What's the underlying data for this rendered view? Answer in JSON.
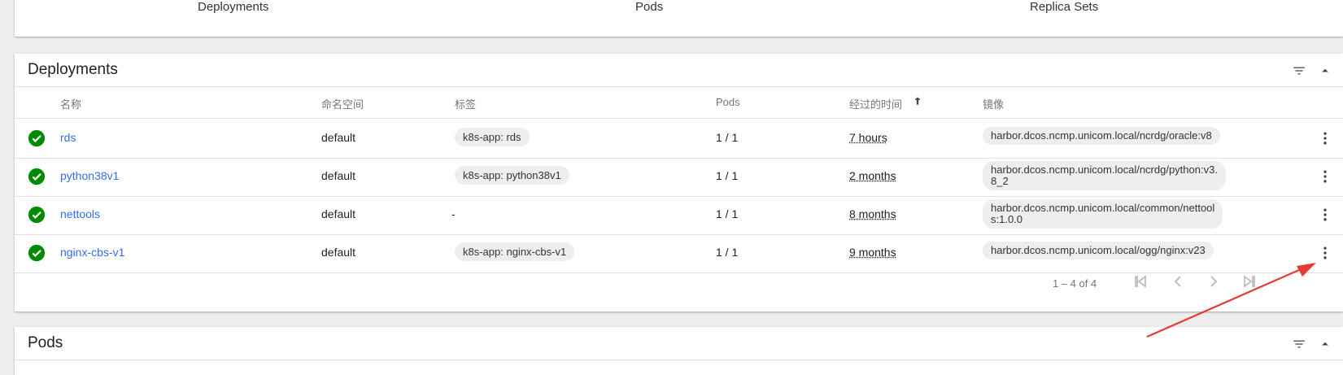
{
  "summary": {
    "labels": [
      "Deployments",
      "Pods",
      "Replica Sets"
    ]
  },
  "deployments": {
    "title": "Deployments",
    "columns": {
      "name": "名称",
      "namespace": "命名空间",
      "labels": "标签",
      "pods": "Pods",
      "age": "经过的时间",
      "images": "镜像"
    },
    "rows": [
      {
        "name": "rds",
        "namespace": "default",
        "label": "k8s-app: rds",
        "pods": "1 / 1",
        "age": "7 hours",
        "image_l1": "harbor.dcos.ncmp.unicom.local/ncrdg/oracle:v8",
        "image_l2": ""
      },
      {
        "name": "python38v1",
        "namespace": "default",
        "label": "k8s-app: python38v1",
        "pods": "1 / 1",
        "age": "2 months",
        "image_l1": "harbor.dcos.ncmp.unicom.local/ncrdg/python:v3.",
        "image_l2": "8_2"
      },
      {
        "name": "nettools",
        "namespace": "default",
        "label": "-",
        "pods": "1 / 1",
        "age": "8 months",
        "image_l1": "harbor.dcos.ncmp.unicom.local/common/nettool",
        "image_l2": "s:1.0.0"
      },
      {
        "name": "nginx-cbs-v1",
        "namespace": "default",
        "label": "k8s-app: nginx-cbs-v1",
        "pods": "1 / 1",
        "age": "9 months",
        "image_l1": "harbor.dcos.ncmp.unicom.local/ogg/nginx:v23",
        "image_l2": ""
      }
    ],
    "pagination": "1 – 4 of 4"
  },
  "pods": {
    "title": "Pods"
  },
  "icons": {
    "status": "check-circle-icon",
    "filter": "filter-icon",
    "collapse": "chevron-up-icon",
    "more": "more-vert-icon",
    "sort": "arrow-up-icon"
  },
  "colors": {
    "link": "#326de6",
    "success": "#00a35e",
    "annotation": "#e53935"
  }
}
